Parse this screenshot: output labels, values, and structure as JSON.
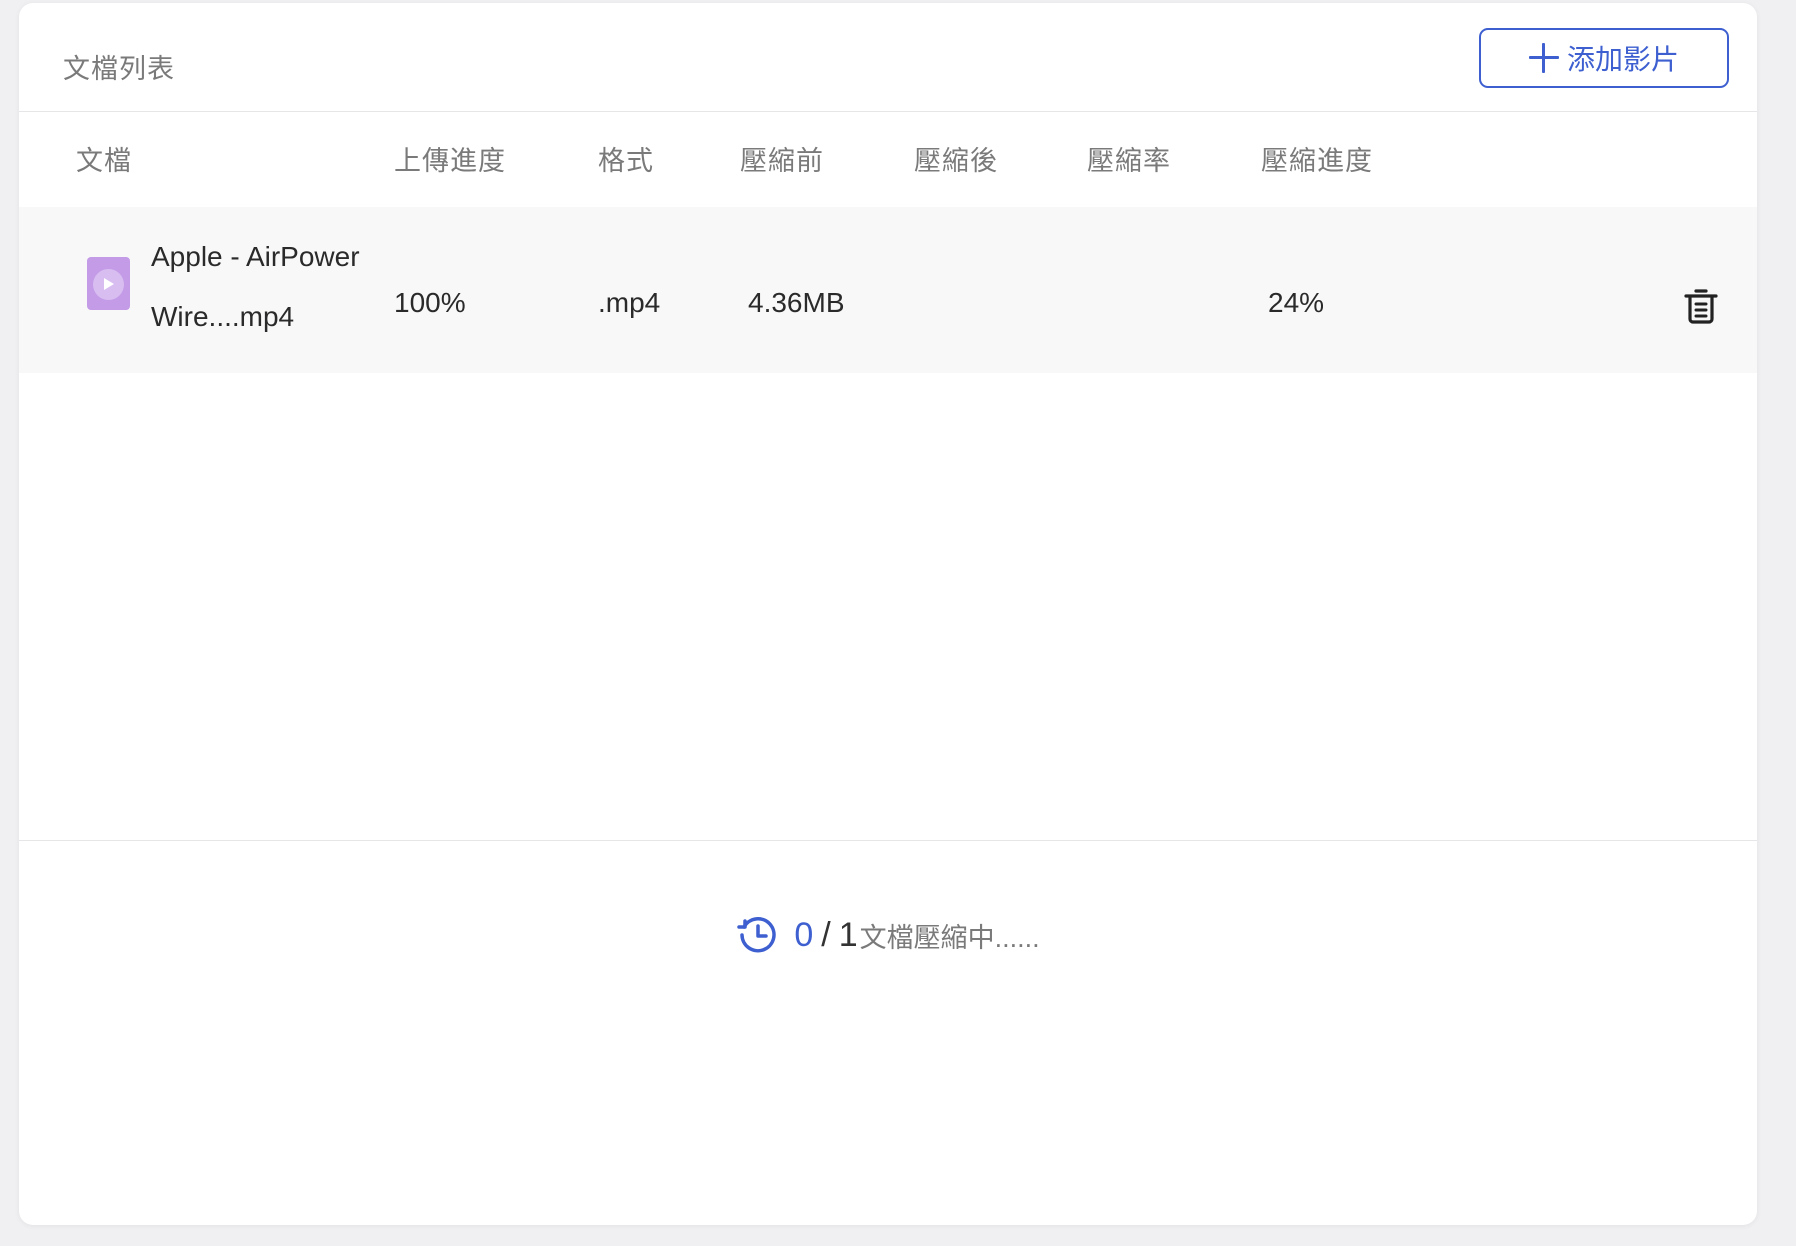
{
  "header": {
    "title": "文檔列表",
    "add_button_label": "添加影片",
    "accent_color": "#3d5fd0"
  },
  "columns": [
    "文檔",
    "上傳進度",
    "格式",
    "壓縮前",
    "壓縮後",
    "壓縮率",
    "壓縮進度"
  ],
  "files": [
    {
      "name_line1": "Apple - AirPower",
      "name_line2": "Wire....mp4",
      "upload_progress": "100%",
      "format": ".mp4",
      "size_before": "4.36MB",
      "size_after": "",
      "compression_rate": "",
      "compression_progress": "24%",
      "icon": "video-file-icon",
      "icon_color": "#c39be6"
    }
  ],
  "status": {
    "done": "0",
    "separator": "/",
    "total": "1",
    "text": "文檔壓縮中......",
    "icon": "clock-icon"
  }
}
